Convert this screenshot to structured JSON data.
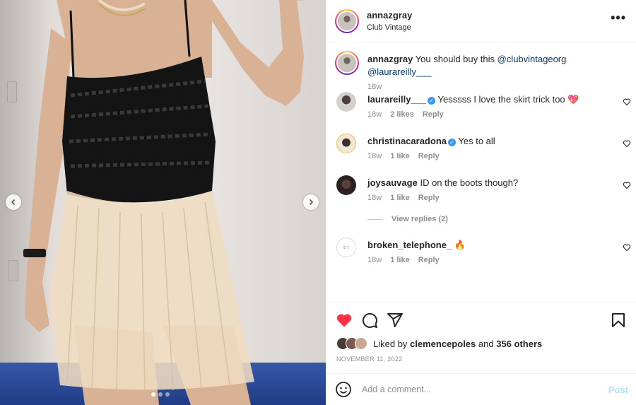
{
  "post": {
    "username": "annazgray",
    "location": "Club Vintage",
    "more_icon": "ellipsis-icon"
  },
  "caption": {
    "username": "annazgray",
    "text": "You should buy this",
    "mentions": [
      "@clubvintageorg",
      "@laurareilly___"
    ],
    "time": "18w"
  },
  "comments": [
    {
      "username": "laurareilly___",
      "verified": true,
      "text": "Yesssss I love the skirt trick too",
      "emoji": "heart-emoji",
      "time": "18w",
      "likes": "2 likes",
      "reply": "Reply"
    },
    {
      "username": "christinacaradona",
      "verified": true,
      "text": "Yes to all",
      "time": "18w",
      "likes": "1 like",
      "reply": "Reply"
    },
    {
      "username": "joysauvage",
      "verified": false,
      "text": "ID on the boots though?",
      "time": "18w",
      "likes": "1 like",
      "reply": "Reply"
    },
    {
      "username": "broken_telephone_",
      "verified": false,
      "text": "",
      "emoji": "fire-emoji",
      "time": "18w",
      "likes": "1 like",
      "reply": "Reply"
    }
  ],
  "view_replies": "View replies (2)",
  "actions": {
    "like_icon": "heart-filled-icon",
    "comment_icon": "comment-icon",
    "share_icon": "share-icon",
    "save_icon": "bookmark-icon",
    "like_color": "#ff3040"
  },
  "likes": {
    "prefix": "Liked by",
    "user": "clemencepoles",
    "middle": "and",
    "others": "356 others"
  },
  "date": "NOVEMBER 11, 2022",
  "add_comment": {
    "placeholder": "Add a comment...",
    "post_label": "Post",
    "emoji_icon": "smiley-icon"
  },
  "carousel": {
    "prev_icon": "chevron-left-icon",
    "next_icon": "chevron-right-icon",
    "slides": 3,
    "active": 1
  },
  "colors": {
    "link": "#00376b",
    "verified": "#3897f0",
    "muted": "#8e8e8e",
    "post_disabled": "#b2dffc"
  }
}
